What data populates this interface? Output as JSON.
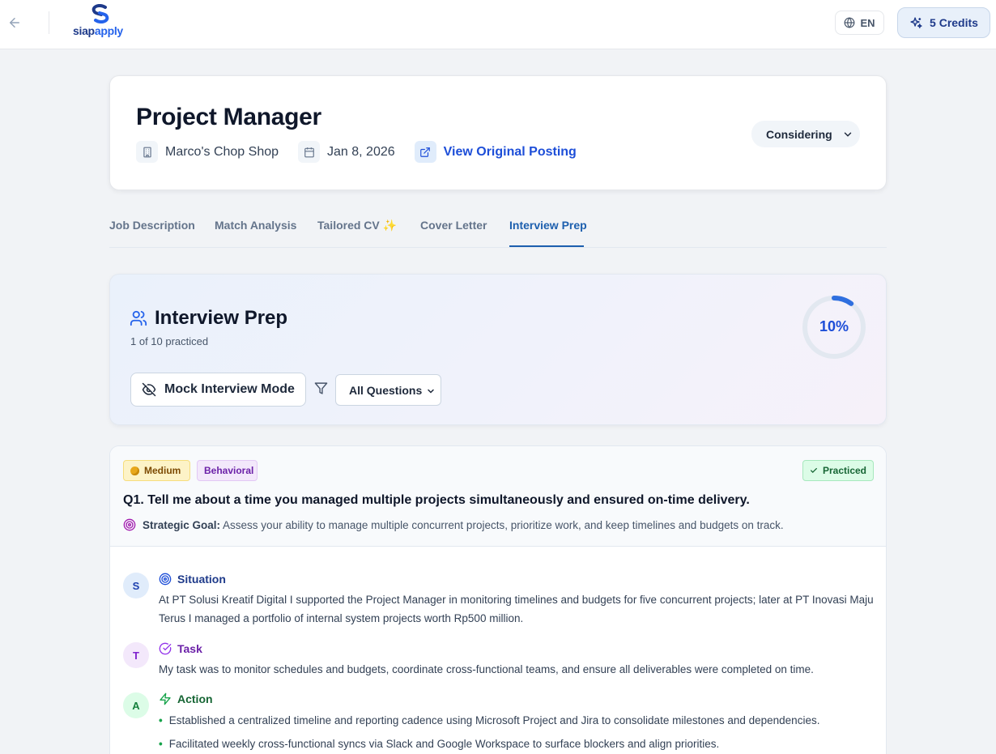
{
  "topbar": {
    "logo_text_1": "siap",
    "logo_text_2": "apply",
    "language": "EN",
    "credits": "5 Credits"
  },
  "job": {
    "title": "Project Manager",
    "company": "Marco's Chop Shop",
    "date": "Jan 8, 2026",
    "posting_link": "View Original Posting",
    "status": "Considering"
  },
  "tabs": [
    {
      "label": "Job Description"
    },
    {
      "label": "Match Analysis"
    },
    {
      "label": "Tailored CV ✨"
    },
    {
      "label": "Cover Letter"
    },
    {
      "label": "Interview Prep"
    }
  ],
  "prep": {
    "title": "Interview Prep",
    "subtitle": "1 of 10 practiced",
    "mock_button": "Mock Interview Mode",
    "filter_value": "All Questions",
    "progress_label": "10%",
    "progress_fraction": 0.1
  },
  "question": {
    "difficulty": "Medium",
    "category": "Behavioral",
    "status": "Practiced",
    "text": "Q1. Tell me about a time you managed multiple projects simultaneously and ensured on-time delivery.",
    "goal_label": "Strategic Goal:",
    "goal_text": "Assess your ability to manage multiple concurrent projects, prioritize work, and keep timelines and budgets on track.",
    "situation": {
      "letter": "S",
      "label": "Situation",
      "text": "At PT Solusi Kreatif Digital I supported the Project Manager in monitoring timelines and budgets for five concurrent projects; later at PT Inovasi Maju Terus I managed a portfolio of internal system projects worth Rp500 million."
    },
    "task": {
      "letter": "T",
      "label": "Task",
      "text": "My task was to monitor schedules and budgets, coordinate cross-functional teams, and ensure all deliverables were completed on time."
    },
    "action": {
      "letter": "A",
      "label": "Action",
      "items": [
        "Established a centralized timeline and reporting cadence using Microsoft Project and Jira to consolidate milestones and dependencies.",
        "Facilitated weekly cross-functional syncs via Slack and Google Workspace to surface blockers and align priorities."
      ]
    }
  },
  "colors": {
    "accent": "#1d5fae",
    "progress": "#2f6fdf",
    "page_bg": "#f1f3f6"
  }
}
